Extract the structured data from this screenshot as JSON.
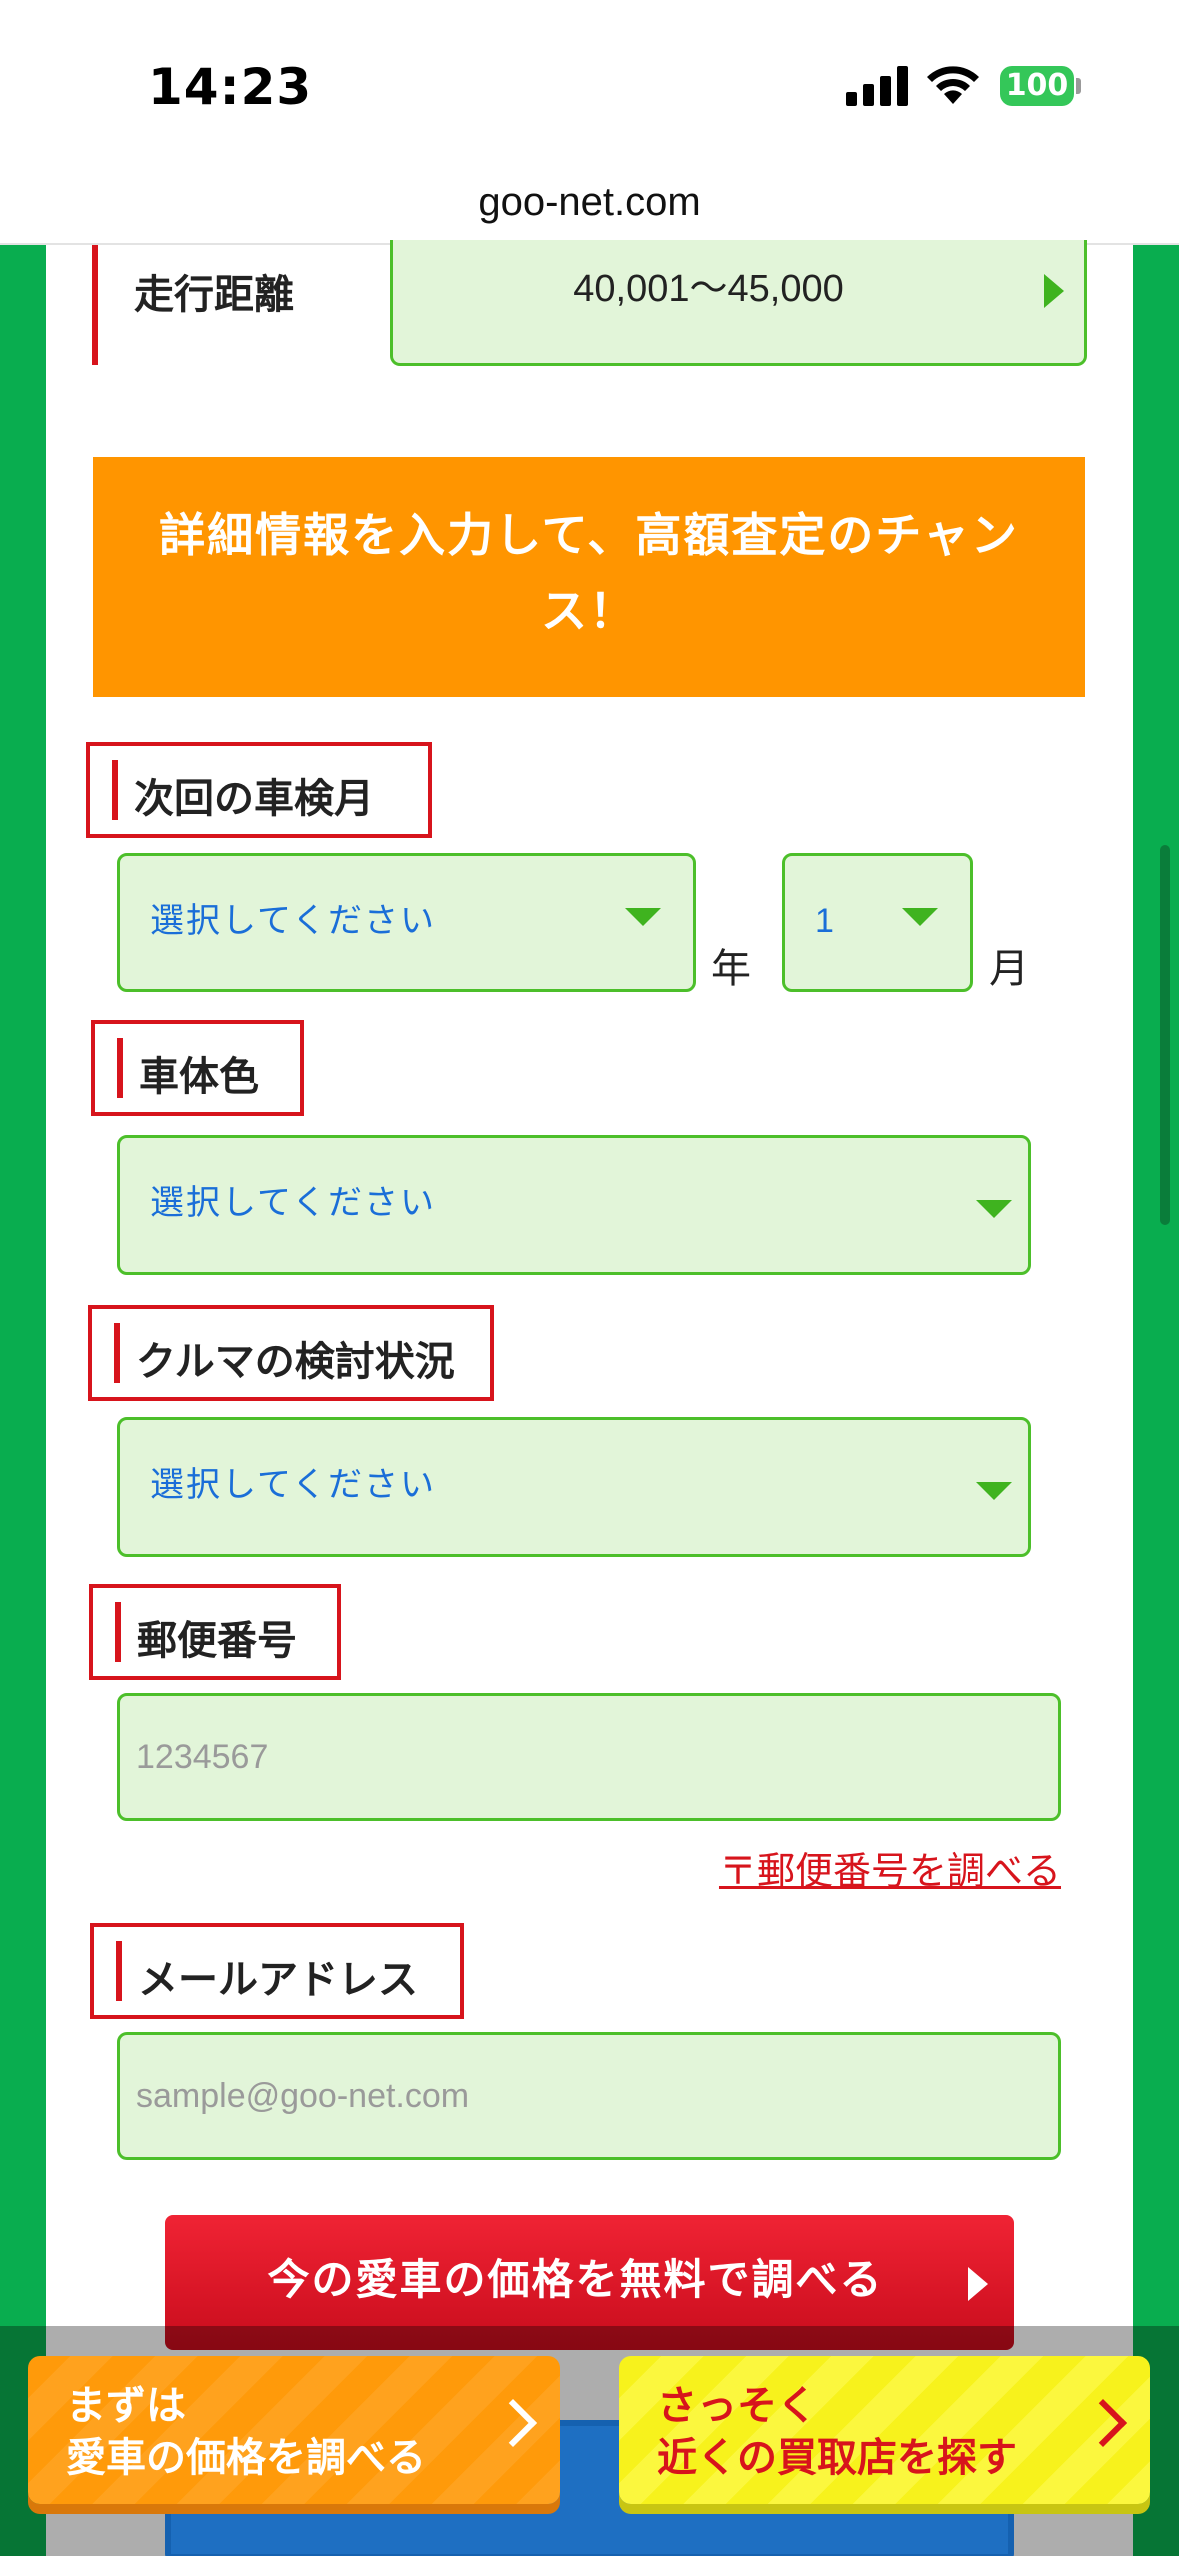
{
  "status_bar": {
    "time": "14:23",
    "battery": "100"
  },
  "browser": {
    "url": "goo-net.com"
  },
  "mileage": {
    "label": "走行距離",
    "value": "40,001〜45,000"
  },
  "banner": {
    "text": "詳細情報を入力して、高額査定のチャンス！"
  },
  "inspection": {
    "label": "次回の車検月",
    "year_placeholder": "選択してください",
    "year_unit": "年",
    "month_value": "1",
    "month_unit": "月"
  },
  "body_color": {
    "label": "車体色",
    "placeholder": "選択してください"
  },
  "status": {
    "label": "クルマの検討状況",
    "placeholder": "選択してください"
  },
  "zip": {
    "label": "郵便番号",
    "placeholder": "1234567",
    "lookup_link": "〒郵便番号を調べる"
  },
  "email": {
    "label": "メールアドレス",
    "placeholder": "sample@goo-net.com"
  },
  "submit": {
    "label": "今の愛車の価格を無料で調べる"
  },
  "bottom_bar": {
    "left_line1": "まずは",
    "left_line2": "愛車の価格を調べる",
    "right_line1": "さっそく",
    "right_line2": "近くの買取店を探す"
  },
  "colors": {
    "brand_green": "#09ad4f",
    "field_bg": "#e2f5d9",
    "accent_red": "#d7141c",
    "banner_orange": "#ff9500"
  }
}
